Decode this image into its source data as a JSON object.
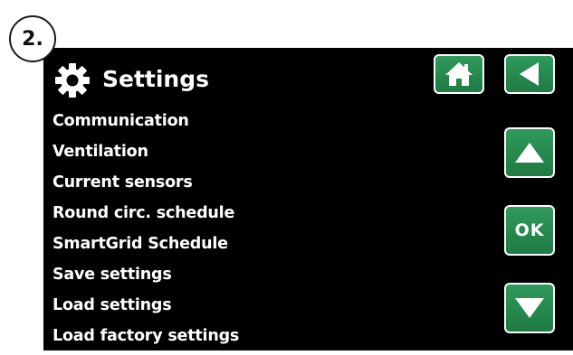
{
  "step": {
    "label": "2."
  },
  "header": {
    "icon": "gear-icon",
    "title": "Settings"
  },
  "menu": {
    "items": [
      {
        "label": "Communication"
      },
      {
        "label": "Ventilation"
      },
      {
        "label": "Current sensors"
      },
      {
        "label": "Round circ. schedule"
      },
      {
        "label": "SmartGrid Schedule"
      },
      {
        "label": "Save settings"
      },
      {
        "label": "Load settings"
      },
      {
        "label": "Load factory settings"
      }
    ]
  },
  "buttons": {
    "home": {
      "icon": "home-icon"
    },
    "back": {
      "icon": "back-arrow-icon"
    },
    "up": {
      "icon": "arrow-up-icon"
    },
    "ok": {
      "label": "OK"
    },
    "down": {
      "icon": "arrow-down-icon"
    }
  },
  "colors": {
    "screen_background": "#000000",
    "text": "#ffffff",
    "button_green": "#2a8c50",
    "button_border": "#ffffff"
  }
}
